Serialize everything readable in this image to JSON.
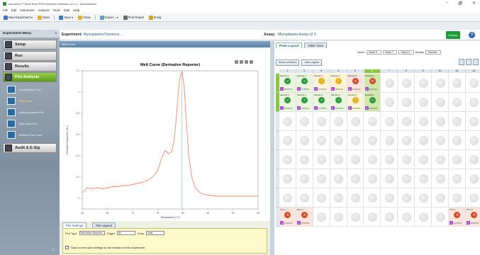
{
  "window": {
    "title": "AccuSEQ™ Real-Time PCR Detection Software v2.1.1 - Administrator",
    "min": "–",
    "max": "🗗",
    "close": "✕"
  },
  "menubar": [
    "File",
    "Edit",
    "Instrument",
    "Analysis",
    "Tools",
    "SAE",
    "Help"
  ],
  "toolbar": [
    {
      "label": "New Experiment ▾",
      "color": "#3a78c3"
    },
    {
      "label": "Open",
      "color": "#e6b22c"
    },
    {
      "label": "Save ▾",
      "color": "#3a78c3"
    },
    {
      "label": "Close",
      "color": "#e6b22c"
    },
    {
      "label": "Export... ▾",
      "color": "#5aa0d8"
    },
    {
      "label": "Print Report",
      "color": "#6a6a6a"
    },
    {
      "label": "B-Sig",
      "color": "#d8a021"
    }
  ],
  "sidebar": {
    "title": "Experiment Menu",
    "collapse": "«",
    "nav": [
      {
        "label": "Setup",
        "active": false
      },
      {
        "label": "Run",
        "active": false
      },
      {
        "label": "Results",
        "active": false
      },
      {
        "label": "Plot Analysis",
        "active": true
      }
    ],
    "plots": [
      {
        "label": "Amplification Plot",
        "active": false
      },
      {
        "label": "Melt Curve",
        "active": true
      },
      {
        "label": "Multicomponent Plot",
        "active": false
      },
      {
        "label": "Raw Data Plot",
        "active": false
      },
      {
        "label": "Multiple Plots View",
        "active": false
      }
    ],
    "audit": "Audit & E-Sig",
    "bottom_collapse": "«"
  },
  "header": {
    "experiment_label": "Experiment:",
    "experiment_value": "Mycoplasma Presence ...",
    "assay_label": "Assay:",
    "assay_value": "Mycoplasma Assay v2 0",
    "apply": "Analyze",
    "help": "?"
  },
  "plot": {
    "panel_title": "Melt Curve",
    "settings_tabs": [
      "Plot Settings",
      "Plot Legend"
    ],
    "plot_type_label": "Plot Type",
    "plot_type_value": "Derivative Reporter",
    "target_label": "Target",
    "target_value": "All",
    "color_label": "Color",
    "color_value": "Well",
    "save_default_label": "Save current plot settings as the default for this experiment"
  },
  "chart_data": {
    "type": "line",
    "title": "Melt Curve (Derivative Reporter)",
    "xlabel": "Temperature (°C)",
    "ylabel": "Derivative Reporter (-Rn')",
    "xlim": [
      60,
      95
    ],
    "ylim": [
      -0.1,
      1.2
    ],
    "x_ticks": [
      60,
      65,
      70,
      75,
      80,
      85,
      90,
      95
    ],
    "y_ticks": [
      0,
      0.2,
      0.4,
      0.6,
      0.8,
      1.0,
      1.2
    ],
    "threshold_x": 79.8,
    "series": [
      {
        "color": "#f08a6a",
        "x": [
          60,
          61,
          62,
          63,
          64,
          65,
          66,
          67,
          68,
          69,
          70,
          71,
          72,
          73,
          74,
          75,
          75.8,
          76.5,
          77.2,
          77.8,
          78.3,
          78.8,
          79.2,
          79.6,
          79.9,
          80.3,
          80.7,
          81.2,
          81.8,
          82.5,
          83.5,
          85,
          87,
          89,
          91,
          93,
          95
        ],
        "values": [
          0.05,
          0.1,
          0.09,
          0.1,
          0.09,
          0.1,
          0.11,
          0.11,
          0.12,
          0.12,
          0.13,
          0.14,
          0.15,
          0.17,
          0.2,
          0.26,
          0.38,
          0.45,
          0.42,
          0.44,
          0.55,
          0.8,
          1.05,
          1.17,
          1.19,
          1.05,
          0.75,
          0.4,
          0.2,
          0.1,
          0.05,
          0.03,
          0.02,
          0.02,
          0.02,
          0.02,
          0.02
        ]
      }
    ],
    "grid": false
  },
  "plate": {
    "tabs": [
      "Plate Layout",
      "Table View"
    ],
    "select_label": "Select:",
    "select_dd": [
      "Select S...",
      "Select T...",
      "Select D..."
    ],
    "display_label": "Display:",
    "display_dd": "Selected...",
    "show_in_wells": "Show in Wells ▾",
    "view_legend": "View Legend",
    "columns": [
      "1",
      "2",
      "3",
      "4",
      "5",
      "6",
      "7",
      "8",
      "9",
      "10",
      "11",
      "12"
    ],
    "rows": [
      "A",
      "B",
      "C",
      "D",
      "E",
      "F",
      "G",
      "H"
    ],
    "selected_column": 5,
    "wells": [
      {
        "row": 0,
        "col": 0,
        "name": "Sample 1",
        "status": "ok",
        "task": "U",
        "tag": "08 MYCO"
      },
      {
        "row": 0,
        "col": 1,
        "name": "Sample 2",
        "status": "ok",
        "task": "U",
        "tag": "07 MYCO"
      },
      {
        "row": 0,
        "col": 2,
        "name": "Sample 3",
        "status": "ylw",
        "task": "U",
        "tag": "01 MYCO"
      },
      {
        "row": 0,
        "col": 3,
        "name": "Sample 4",
        "status": "ylw",
        "task": "U",
        "tag": "05 MYCO"
      },
      {
        "row": 0,
        "col": 4,
        "name": "Sample 5",
        "status": "pos",
        "task": "U",
        "tag": "04 MYCO"
      },
      {
        "row": 0,
        "col": 5,
        "name": "Sample 6",
        "status": "pos",
        "task": "U",
        "tag": "06 MYCO"
      },
      {
        "row": 1,
        "col": 0,
        "name": "Sample 1",
        "status": "ok",
        "task": "U",
        "tag": "08 MYCO"
      },
      {
        "row": 1,
        "col": 1,
        "name": "Sample 2",
        "status": "ok",
        "task": "U",
        "tag": "07 MYCO"
      },
      {
        "row": 1,
        "col": 2,
        "name": "Sample 3",
        "status": "ok",
        "task": "U",
        "tag": "01 MYCO"
      },
      {
        "row": 1,
        "col": 3,
        "name": "Sample 4",
        "status": "ok",
        "task": "U",
        "tag": "05 MYCO"
      },
      {
        "row": 1,
        "col": 4,
        "name": "Sample 5",
        "status": "ylw",
        "task": "U",
        "tag": "04 MYCO"
      },
      {
        "row": 1,
        "col": 5,
        "name": "Sample 6",
        "status": "ok",
        "task": "U",
        "tag": "06 MYCO"
      },
      {
        "row": 7,
        "col": 0,
        "name": "NTC 1",
        "status": "pos",
        "task": "N",
        "tag": "01 MYCO"
      },
      {
        "row": 7,
        "col": 1,
        "name": "NTC 2",
        "status": "pos",
        "task": "N",
        "tag": "07 MYCO"
      },
      {
        "row": 7,
        "col": 10,
        "name": "PTC 1",
        "status": "pos",
        "task": "P",
        "tag": "01 MYCO"
      },
      {
        "row": 7,
        "col": 11,
        "name": "PTC 2",
        "status": "pos",
        "task": "P",
        "tag": "06 MYCO"
      }
    ],
    "status_colors": {
      "ok": "#2f9b3e",
      "ylw": "#e4b21d",
      "pos": "#d64a2e"
    }
  },
  "colors": {
    "accent": "#8cc63f",
    "brand_blue": "#25577e",
    "apply_green": "#1d9a3a"
  }
}
